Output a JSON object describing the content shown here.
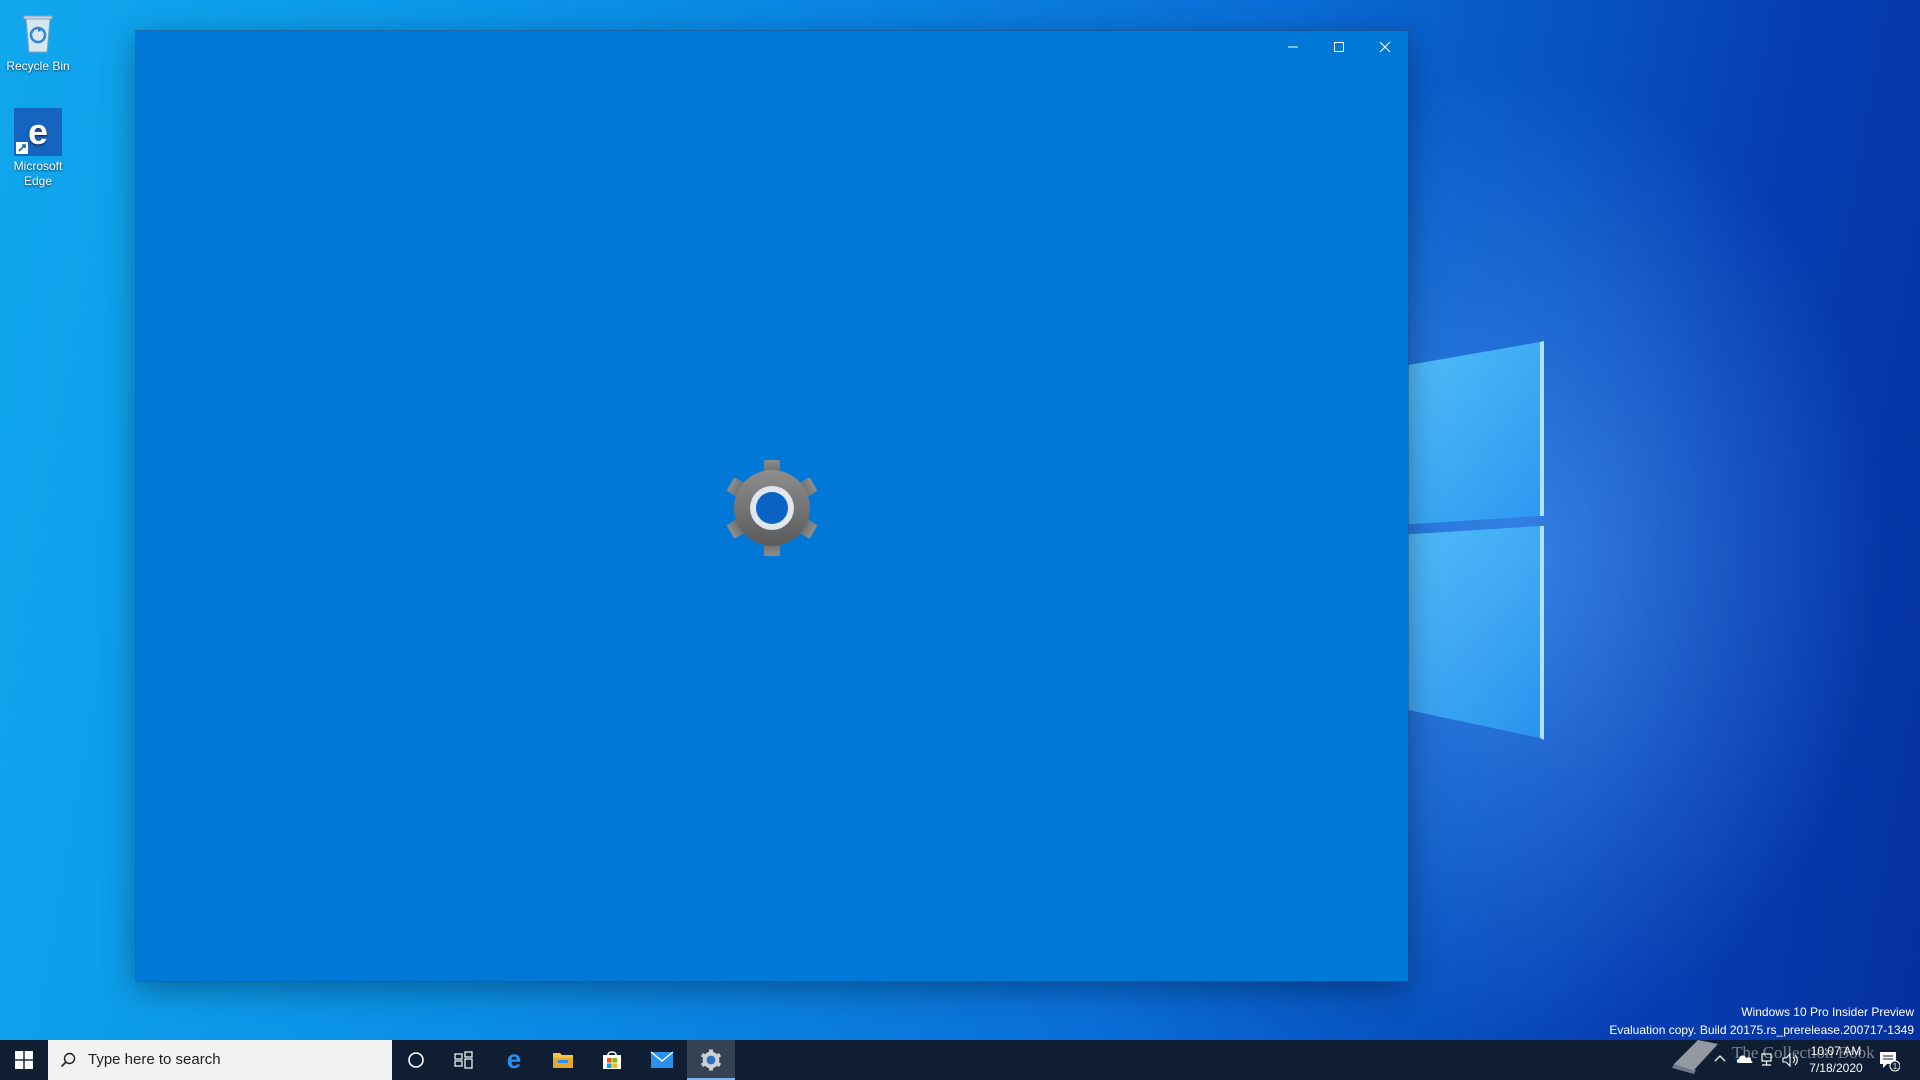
{
  "desktop": {
    "icons": [
      {
        "label": "Recycle Bin"
      },
      {
        "label": "Microsoft Edge"
      }
    ],
    "watermark": {
      "line1": "Windows 10 Pro Insider Preview",
      "line2": "Evaluation copy. Build 20175.rs_prerelease.200717-1349"
    },
    "overlay_text": "The Collection Book"
  },
  "window": {
    "app": "Settings",
    "background": "#0078d7",
    "splash_icon": "settings-gear-icon",
    "caption_buttons": [
      "minimize-icon",
      "maximize-icon",
      "close-icon"
    ]
  },
  "taskbar": {
    "search_placeholder": "Type here to search",
    "pinned": [
      "start-icon",
      "cortana-icon",
      "task-view-icon",
      "edge-icon",
      "file-explorer-icon",
      "store-icon",
      "mail-icon",
      "settings-icon"
    ],
    "active_app": "settings",
    "clock": {
      "time": "10:07 AM",
      "date": "7/18/2020"
    },
    "notification_count": "1"
  }
}
